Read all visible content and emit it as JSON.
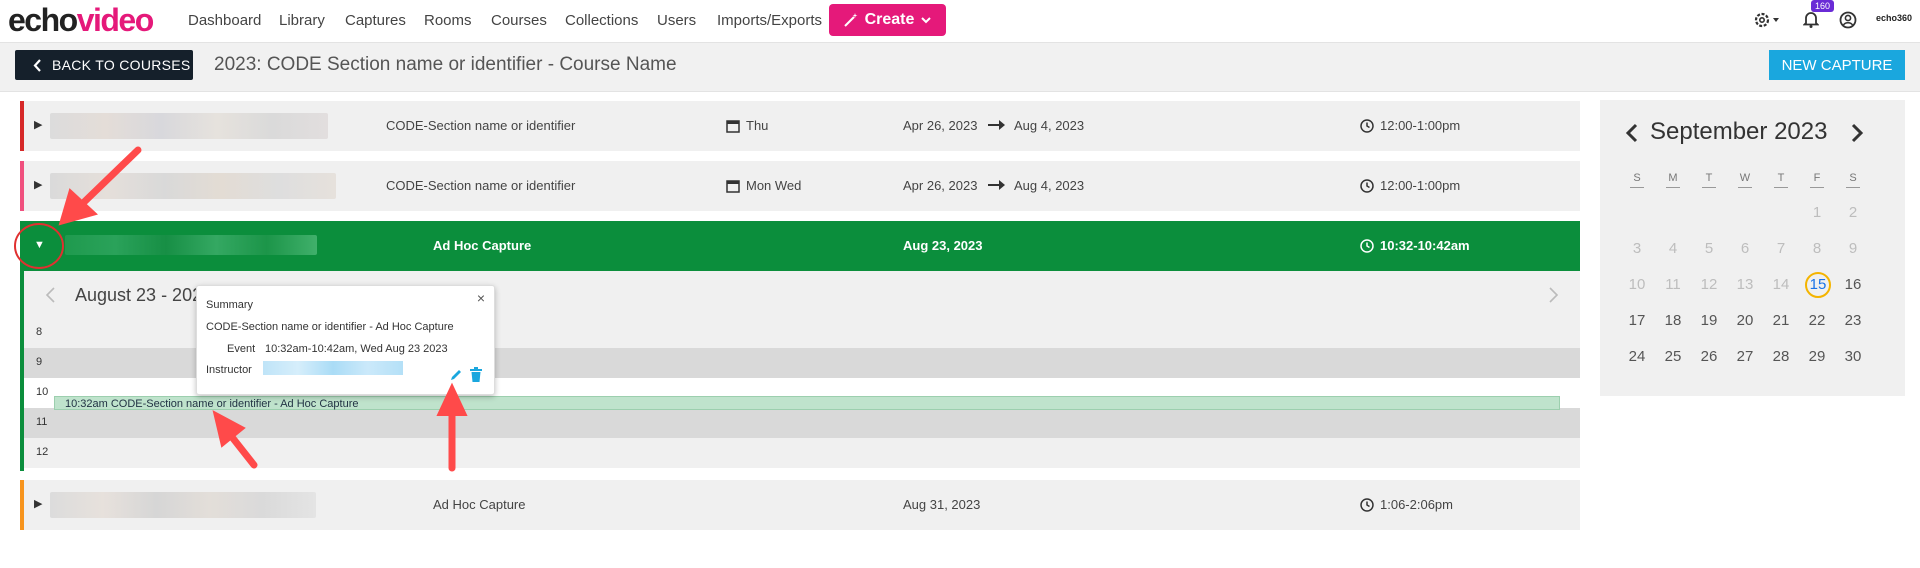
{
  "brand": {
    "part1": "echo",
    "part2": "video",
    "mini": "echo360"
  },
  "nav": {
    "links": [
      "Dashboard",
      "Library",
      "Captures",
      "Rooms",
      "Courses",
      "Collections",
      "Users",
      "Imports/Exports"
    ],
    "create_label": "Create",
    "notification_count": "160"
  },
  "header": {
    "back_label": "BACK TO COURSES",
    "title": "2023: CODE Section name or identifier - Course Name",
    "new_capture_label": "NEW CAPTURE"
  },
  "rows": [
    {
      "section": "CODE-Section name or identifier",
      "days": "Thu",
      "start": "Apr 26, 2023",
      "end": "Aug 4, 2023",
      "time": "12:00-1:00pm",
      "color": "#d62828"
    },
    {
      "section": "CODE-Section name or identifier",
      "days": "Mon Wed",
      "start": "Apr 26, 2023",
      "end": "Aug 4, 2023",
      "time": "12:00-1:00pm",
      "color": "#f0507e"
    },
    {
      "section": "Ad Hoc Capture",
      "date": "Aug 23, 2023",
      "time": "10:32-10:42am",
      "color": "#0b8e3c"
    },
    {
      "section": "Ad Hoc Capture",
      "date": "Aug 31, 2023",
      "time": "1:06-2:06pm",
      "color": "#f7941d"
    }
  ],
  "schedule": {
    "range_title": "August 23 - 202",
    "hours": [
      "8",
      "9",
      "10",
      "11",
      "12"
    ],
    "event_label": "10:32am CODE-Section name or identifier - Ad Hoc Capture"
  },
  "popover": {
    "heading": "Summary",
    "title": "CODE-Section name or identifier - Ad Hoc Capture",
    "event_label": "Event",
    "event_value": "10:32am-10:42am, Wed Aug 23 2023",
    "instructor_label": "Instructor",
    "close": "×"
  },
  "calendar": {
    "month_title": "September 2023",
    "weekdays": [
      "S",
      "M",
      "T",
      "W",
      "T",
      "F",
      "S"
    ],
    "weeks": [
      [
        "",
        "",
        "",
        "",
        "",
        "1",
        "2"
      ],
      [
        "3",
        "4",
        "5",
        "6",
        "7",
        "8",
        "9"
      ],
      [
        "10",
        "11",
        "12",
        "13",
        "14",
        "15",
        "16"
      ],
      [
        "17",
        "18",
        "19",
        "20",
        "21",
        "22",
        "23"
      ],
      [
        "24",
        "25",
        "26",
        "27",
        "28",
        "29",
        "30"
      ]
    ],
    "today": "15",
    "accent": "#f4b400"
  },
  "colors": {
    "brand_pink": "#e5197a",
    "dark": "#15202b",
    "blue": "#1aa7de",
    "green": "#0b8e3c",
    "annotation_red": "#ff4a4a"
  }
}
